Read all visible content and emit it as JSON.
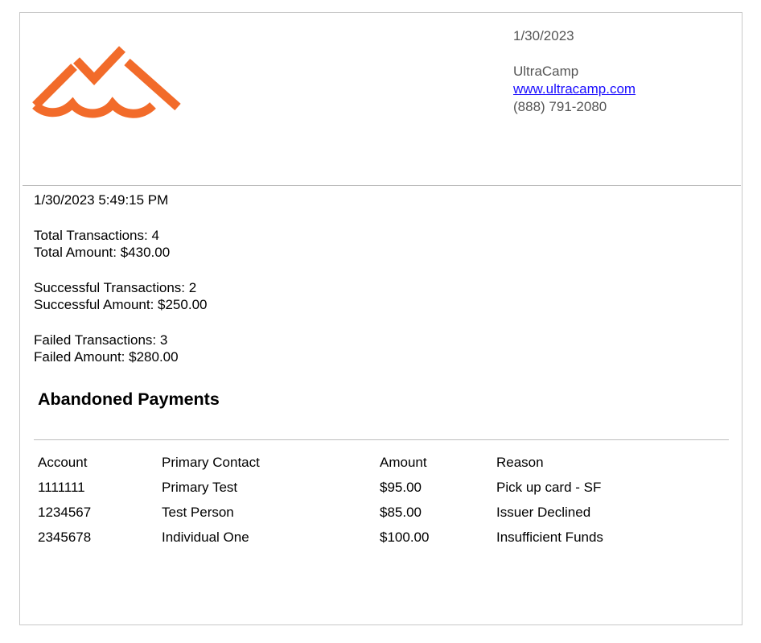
{
  "header": {
    "date": "1/30/2023",
    "company_name": "UltraCamp",
    "website": "www.ultracamp.com",
    "phone": "(888) 791-2080",
    "logo_icon": "ultracamp-logo-icon",
    "logo_color": "#F26B2A"
  },
  "summary": {
    "timestamp": "1/30/2023 5:49:15 PM",
    "total_transactions": "Total Transactions: 4",
    "total_amount": "Total Amount: $430.00",
    "successful_transactions": "Successful Transactions: 2",
    "successful_amount": "Successful Amount: $250.00",
    "failed_transactions": "Failed Transactions: 3",
    "failed_amount": "Failed Amount: $280.00"
  },
  "abandoned": {
    "title": "Abandoned Payments",
    "columns": [
      "Account",
      "Primary Contact",
      "Amount",
      "Reason"
    ],
    "rows": [
      [
        "1111111",
        "Primary Test",
        "$95.00",
        "Pick up card - SF"
      ],
      [
        "1234567",
        "Test Person",
        "$85.00",
        "Issuer Declined"
      ],
      [
        "2345678",
        "Individual One",
        "$100.00",
        "Insufficient Funds"
      ]
    ]
  }
}
